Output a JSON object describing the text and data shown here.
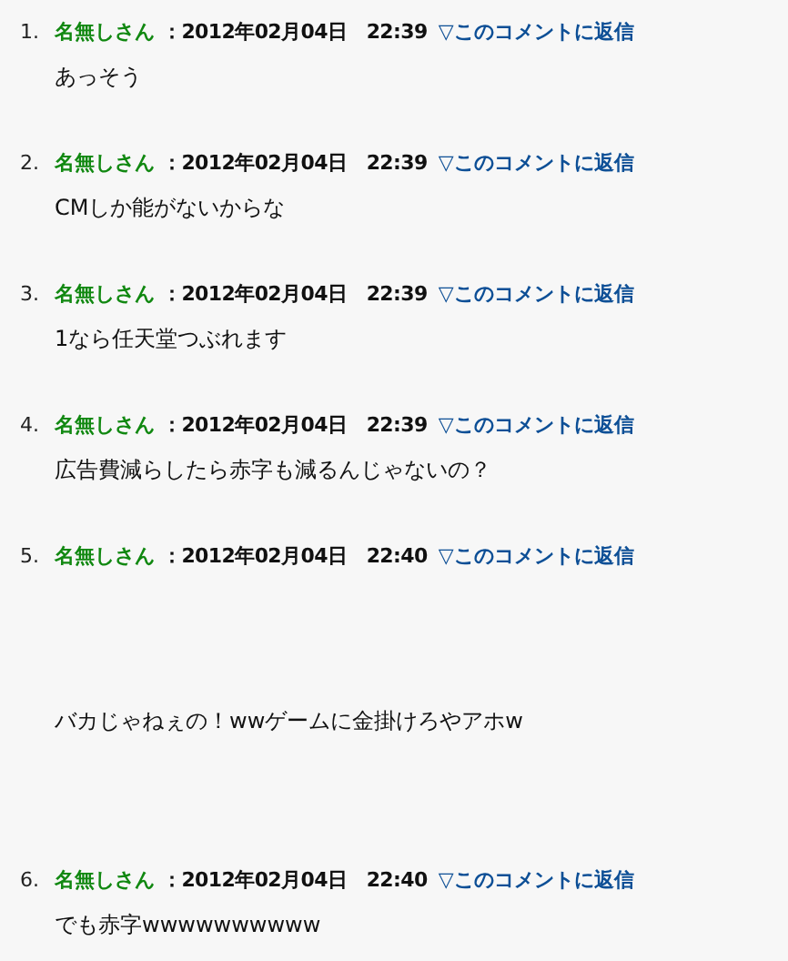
{
  "comments": [
    {
      "number": "1.",
      "name": "名無しさん",
      "date": "：2012年02月04日　22:39",
      "reply_link": "▽このコメントに返信",
      "body": "あっそう",
      "kind": "normal"
    },
    {
      "number": "2.",
      "name": "名無しさん",
      "date": "：2012年02月04日　22:39",
      "reply_link": "▽このコメントに返信",
      "body": "CMしか能がないからな",
      "kind": "normal"
    },
    {
      "number": "3.",
      "name": "名無しさん",
      "date": "：2012年02月04日　22:39",
      "reply_link": "▽このコメントに返信",
      "body": "1なら任天堂つぶれます",
      "kind": "normal"
    },
    {
      "number": "4.",
      "name": "名無しさん",
      "date": "：2012年02月04日　22:39",
      "reply_link": "▽このコメントに返信",
      "body": "広告費減らしたら赤字も減るんじゃないの？",
      "kind": "normal"
    },
    {
      "number": "5.",
      "name": "名無しさん",
      "date": "：2012年02月04日　22:40",
      "reply_link": "▽このコメントに返信",
      "body": "バカじゃねぇの！wwゲームに金掛けろやアホw",
      "kind": "padded"
    },
    {
      "number": "6.",
      "name": "名無しさん",
      "date": "：2012年02月04日　22:40",
      "reply_link": "▽このコメントに返信",
      "body": "でも赤字wwwwwwwwww",
      "kind": "normal"
    }
  ]
}
